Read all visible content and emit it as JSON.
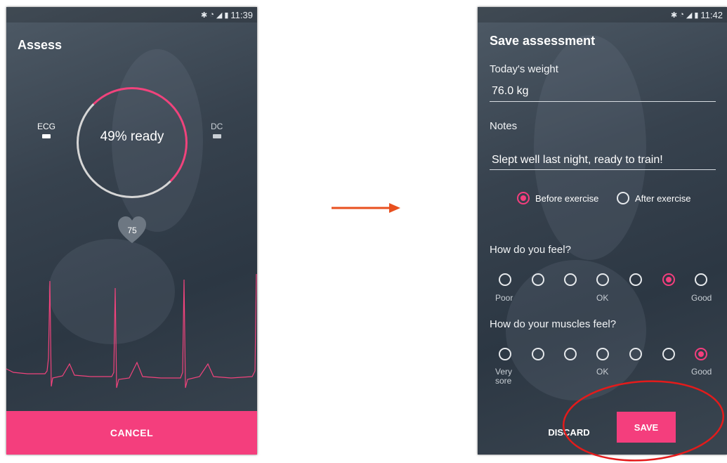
{
  "left_screen": {
    "status_time": "11:39",
    "title": "Assess",
    "readiness_text": "49% ready",
    "readiness_percent": 49,
    "sensor_left": "ECG",
    "sensor_right": "DC",
    "heart_rate": "75",
    "cancel_label": "CANCEL"
  },
  "right_screen": {
    "status_time": "11:42",
    "title": "Save assessment",
    "weight_label": "Today's weight",
    "weight_value": "76.0 kg",
    "notes_label": "Notes",
    "notes_value": "Slept well last night, ready to train!",
    "timing_options": [
      {
        "label": "Before exercise",
        "selected": true
      },
      {
        "label": "After exercise",
        "selected": false
      }
    ],
    "feel_question": "How do you feel?",
    "feel_scale": {
      "min_label": "Poor",
      "mid_label": "OK",
      "max_label": "Good",
      "points": 7,
      "selected_index": 5
    },
    "muscles_question": "How do your muscles feel?",
    "muscles_scale": {
      "min_label": "Very sore",
      "mid_label": "OK",
      "max_label": "Good",
      "points": 7,
      "selected_index": 6
    },
    "discard_label": "DISCARD",
    "save_label": "SAVE"
  },
  "colors": {
    "accent": "#f43e7d",
    "arrow": "#e8501f",
    "highlight": "#e31b1b",
    "background": "#2e3945"
  },
  "icons": [
    "bluetooth-icon",
    "wifi-icon",
    "signal-icon",
    "battery-icon",
    "heart-icon"
  ]
}
